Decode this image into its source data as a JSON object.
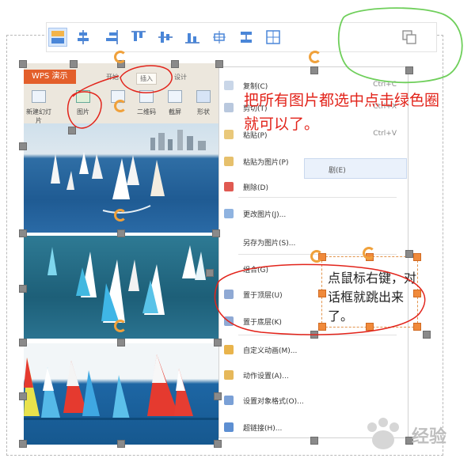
{
  "toolbar": {
    "tools": [
      {
        "name": "align-left-icon"
      },
      {
        "name": "align-center-icon"
      },
      {
        "name": "align-right-icon"
      },
      {
        "name": "align-top-icon"
      },
      {
        "name": "align-middle-icon"
      },
      {
        "name": "align-bottom-icon"
      },
      {
        "name": "distribute-horizontal-icon"
      },
      {
        "name": "distribute-vertical-icon"
      },
      {
        "name": "center-on-page-icon"
      },
      {
        "name": "group-icon"
      }
    ]
  },
  "ribbon": {
    "app_tab": "WPS 演示",
    "tabs": [
      "开始",
      "插入",
      "设计"
    ],
    "buttons": [
      "新建幻灯片",
      "图片",
      "",
      "二维码",
      "截屏",
      "形状"
    ]
  },
  "context_menu": {
    "items": [
      {
        "label": "复制(C)",
        "shortcut": "Ctrl+C"
      },
      {
        "label": "剪切(T)",
        "shortcut": "Ctrl+X"
      },
      {
        "label": "粘贴(P)",
        "shortcut": "Ctrl+V"
      },
      {
        "label": "粘贴为图片(P)",
        "shortcut": ""
      },
      {
        "label": "删除(D)",
        "shortcut": ""
      },
      {
        "label": "更改图片(J)...",
        "shortcut": ""
      },
      {
        "label": "另存为图片(S)...",
        "shortcut": ""
      },
      {
        "label": "组合(G)",
        "shortcut": ""
      },
      {
        "label": "置于顶层(U)",
        "shortcut": ""
      },
      {
        "label": "置于底层(K)",
        "shortcut": ""
      },
      {
        "label": "自定义动画(M)...",
        "shortcut": ""
      },
      {
        "label": "动作设置(A)...",
        "shortcut": ""
      },
      {
        "label": "设置对象格式(O)...",
        "shortcut": ""
      },
      {
        "label": "超链接(H)...",
        "shortcut": ""
      }
    ],
    "submenu_label": "剧(E)"
  },
  "annotations": {
    "instruction": "把所有图片都选中点击绿色圈就可以了。",
    "textbox": "点鼠标右键，对话框就跳出来了。"
  },
  "watermark": "经验",
  "colors": {
    "annotation_red": "#e2231a",
    "annotation_green": "#6fcf5b",
    "handle_orange": "#f08a3b",
    "handle_gray": "#8a8a8a",
    "wps_orange": "#e35f2b"
  }
}
